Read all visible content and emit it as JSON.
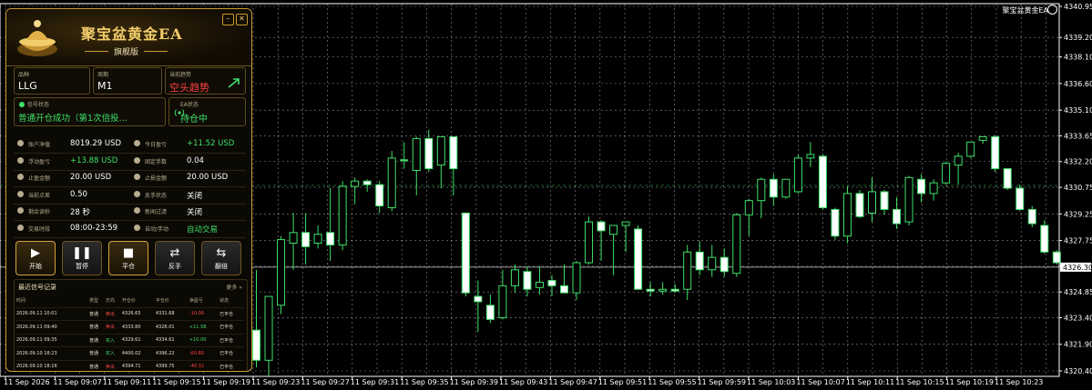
{
  "chart": {
    "ea_name": "聚宝盆黄金EA",
    "price_labels": [
      "4340.95",
      "4339.20",
      "4338.10",
      "4336.60",
      "4335.10",
      "4333.65",
      "4332.20",
      "4330.75",
      "4329.25",
      "4327.75",
      "4326.30",
      "4324.85",
      "4323.40",
      "4321.90",
      "4320.40"
    ],
    "current_price_label": "4326.30",
    "time_labels": [
      "11 Sep 2026",
      "11 Sep 09:07",
      "11 Sep 09:11",
      "11 Sep 09:15",
      "11 Sep 09:19",
      "11 Sep 09:23",
      "11 Sep 09:27",
      "11 Sep 09:31",
      "11 Sep 09:35",
      "11 Sep 09:39",
      "11 Sep 09:43",
      "11 Sep 09:47",
      "11 Sep 09:51",
      "11 Sep 09:55",
      "11 Sep 09:59",
      "11 Sep 10:03",
      "11 Sep 10:07",
      "11 Sep 10:11",
      "11 Sep 10:15",
      "11 Sep 10:19",
      "11 Sep 10:23"
    ],
    "candles": [
      [
        4322.7,
        4326.1,
        4320.6,
        4321.0
      ],
      [
        4321.0,
        4324.6,
        4320.1,
        4324.6
      ],
      [
        4324.1,
        4328.0,
        4323.6,
        4327.8
      ],
      [
        4327.6,
        4329.3,
        4326.1,
        4328.2
      ],
      [
        4328.2,
        4329.3,
        4326.4,
        4327.4
      ],
      [
        4327.6,
        4328.6,
        4327.3,
        4328.1
      ],
      [
        4328.2,
        4330.7,
        4326.6,
        4327.5
      ],
      [
        4327.5,
        4331.1,
        4327.2,
        4330.8
      ],
      [
        4330.8,
        4331.3,
        4329.8,
        4331.1
      ],
      [
        4331.1,
        4331.2,
        4330.5,
        4330.9
      ],
      [
        4330.9,
        4331.1,
        4329.3,
        4329.7
      ],
      [
        4329.6,
        4332.8,
        4329.4,
        4332.4
      ],
      [
        4332.3,
        4333.3,
        4331.8,
        4332.3
      ],
      [
        4331.7,
        4333.6,
        4330.3,
        4333.5
      ],
      [
        4333.5,
        4334.0,
        4331.6,
        4331.8
      ],
      [
        4332.0,
        4333.3,
        4330.7,
        4333.6
      ],
      [
        4333.6,
        4333.6,
        4330.3,
        4331.8
      ],
      [
        4329.3,
        4329.3,
        4324.6,
        4324.8
      ],
      [
        4324.6,
        4325.5,
        4322.6,
        4324.3
      ],
      [
        4324.1,
        4324.7,
        4323.1,
        4323.3
      ],
      [
        4323.4,
        4326.1,
        4323.3,
        4325.2
      ],
      [
        4325.2,
        4326.4,
        4324.8,
        4326.1
      ],
      [
        4326.0,
        4326.3,
        4324.6,
        4325.0
      ],
      [
        4325.1,
        4326.3,
        4324.7,
        4325.4
      ],
      [
        4325.5,
        4325.8,
        4324.6,
        4325.2
      ],
      [
        4325.2,
        4326.4,
        4324.9,
        4324.8
      ],
      [
        4324.8,
        4326.6,
        4324.4,
        4326.5
      ],
      [
        4326.5,
        4329.1,
        4326.4,
        4328.8
      ],
      [
        4328.8,
        4328.9,
        4326.6,
        4328.3
      ],
      [
        4328.1,
        4328.5,
        4325.8,
        4328.6
      ],
      [
        4328.6,
        4328.7,
        4327.1,
        4328.8
      ],
      [
        4328.4,
        4328.6,
        4325.0,
        4325.0
      ],
      [
        4325.0,
        4325.4,
        4324.6,
        4324.9
      ],
      [
        4324.9,
        4325.4,
        4324.7,
        4325.0
      ],
      [
        4325.0,
        4325.3,
        4324.8,
        4324.9
      ],
      [
        4325.0,
        4327.5,
        4324.4,
        4327.1
      ],
      [
        4327.1,
        4327.7,
        4325.8,
        4326.1
      ],
      [
        4326.1,
        4327.5,
        4325.7,
        4326.8
      ],
      [
        4326.8,
        4327.3,
        4325.7,
        4326.0
      ],
      [
        4325.9,
        4329.3,
        4325.7,
        4329.2
      ],
      [
        4329.2,
        4330.1,
        4328.0,
        4330.0
      ],
      [
        4330.0,
        4331.3,
        4329.0,
        4331.2
      ],
      [
        4331.2,
        4331.5,
        4329.7,
        4330.2
      ],
      [
        4330.2,
        4331.2,
        4330.1,
        4331.2
      ],
      [
        4330.5,
        4332.6,
        4330.4,
        4332.4
      ],
      [
        4332.4,
        4333.3,
        4331.9,
        4332.6
      ],
      [
        4332.5,
        4332.6,
        4329.5,
        4329.6
      ],
      [
        4329.5,
        4329.6,
        4327.8,
        4328.0
      ],
      [
        4328.0,
        4330.8,
        4327.6,
        4330.4
      ],
      [
        4330.4,
        4330.6,
        4329.0,
        4329.1
      ],
      [
        4329.3,
        4331.3,
        4328.8,
        4330.5
      ],
      [
        4330.5,
        4330.6,
        4329.2,
        4329.5
      ],
      [
        4329.5,
        4330.2,
        4328.4,
        4328.7
      ],
      [
        4328.8,
        4331.4,
        4328.6,
        4331.3
      ],
      [
        4331.2,
        4331.5,
        4329.9,
        4330.4
      ],
      [
        4330.4,
        4331.2,
        4330.0,
        4331.0
      ],
      [
        4331.0,
        4332.2,
        4330.9,
        4332.1
      ],
      [
        4332.0,
        4332.7,
        4330.9,
        4332.5
      ],
      [
        4332.5,
        4333.1,
        4332.4,
        4333.3
      ],
      [
        4333.4,
        4333.6,
        4333.2,
        4333.6
      ],
      [
        4333.6,
        4333.7,
        4331.6,
        4331.8
      ],
      [
        4331.8,
        4331.8,
        4330.6,
        4330.7
      ],
      [
        4330.7,
        4330.9,
        4329.4,
        4329.5
      ],
      [
        4329.5,
        4329.7,
        4328.5,
        4328.7
      ],
      [
        4328.6,
        4328.9,
        4327.0,
        4327.1
      ],
      [
        4327.1,
        4327.2,
        4326.4,
        4326.5
      ]
    ]
  },
  "panel": {
    "title": "聚宝盆黄金EA",
    "subtitle": "旗舰版",
    "symbol_label": "品种",
    "symbol": "LLG",
    "period_label": "周期",
    "period": "M1",
    "trend_label": "当前趋势",
    "trend": "空头趋势",
    "signal_label": "信号状态",
    "signal": "普通开仓成功（第1次倍投...",
    "ea_status_label": "EA状态",
    "ea_status": "持仓中",
    "stats": [
      {
        "k": "账户净值",
        "v": "8019.29 USD",
        "color": "#ffffff"
      },
      {
        "k": "今日盈亏",
        "v": "+11.52 USD",
        "color": "#3ee06a"
      },
      {
        "k": "浮动盈亏",
        "v": "+13.88 USD",
        "color": "#3ee06a"
      },
      {
        "k": "固定手数",
        "v": "0.04",
        "color": "#ffffff"
      },
      {
        "k": "止盈金额",
        "v": "20.00 USD",
        "color": "#ffffff"
      },
      {
        "k": "止损金额",
        "v": "20.00 USD",
        "color": "#ffffff"
      },
      {
        "k": "当前点差",
        "v": "0.50",
        "color": "#ffffff"
      },
      {
        "k": "反手状态",
        "v": "关闭",
        "color": "#ffffff"
      },
      {
        "k": "剩余读秒",
        "v": "28 秒",
        "color": "#ffffff"
      },
      {
        "k": "新闻过滤",
        "v": "关闭",
        "color": "#ffffff"
      },
      {
        "k": "交易时段",
        "v": "08:00-23:59",
        "color": "#ffffff"
      },
      {
        "k": "自动/手动",
        "v": "自动交易",
        "color": "#3ee06a"
      }
    ],
    "buttons": [
      {
        "label": "开始",
        "glyph": "▶"
      },
      {
        "label": "暂停",
        "glyph": "❚❚"
      },
      {
        "label": "平仓",
        "glyph": "■"
      },
      {
        "label": "反手",
        "glyph": "⇄"
      },
      {
        "label": "翻倍",
        "glyph": "⇆"
      }
    ],
    "signals_title": "最近信号记录",
    "signals_more": "更多 »",
    "signal_columns": [
      "时间",
      "类型",
      "方向",
      "开仓价",
      "平仓价",
      "净盈亏",
      "状态"
    ],
    "signal_rows": [
      [
        "2026.09.11 10:01",
        "普通",
        "卖出",
        "4326.65",
        "4331.68",
        "-10.06",
        "已平仓"
      ],
      [
        "2026.09.11 09:40",
        "普通",
        "卖出",
        "4333.80",
        "4328.01",
        "+11.58",
        "已平仓"
      ],
      [
        "2026.09.11 09:35",
        "普通",
        "买入",
        "4329.61",
        "4334.61",
        "+10.00",
        "已平仓"
      ],
      [
        "2026.09.10 18:23",
        "普通",
        "买入",
        "4400.02",
        "4396.22",
        "-60.80",
        "已平仓"
      ],
      [
        "2026.09.10 18:16",
        "普通",
        "卖出",
        "4394.71",
        "4399.75",
        "-40.32",
        "已平仓"
      ]
    ],
    "colors": {
      "buy": "#3ee06a",
      "sell": "#ff4040",
      "gold": "#c89a32",
      "up": "#3ee06a",
      "down": "#ffffff"
    }
  }
}
